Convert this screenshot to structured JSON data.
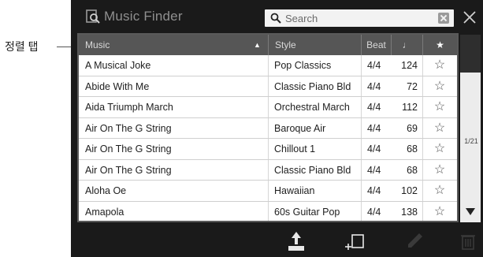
{
  "annotation": {
    "callout_label": "정렬 탭"
  },
  "titlebar": {
    "title": "Music Finder",
    "icon": "music-finder-icon"
  },
  "search": {
    "placeholder": "Search"
  },
  "table": {
    "columns": [
      {
        "key": "music",
        "label": "Music"
      },
      {
        "key": "style",
        "label": "Style"
      },
      {
        "key": "beat",
        "label": "Beat"
      },
      {
        "key": "tempo",
        "label": "♩"
      },
      {
        "key": "favorite",
        "label": "★"
      }
    ],
    "sort_indicator": "▲",
    "rows": [
      {
        "music": "A Musical Joke",
        "style": "Pop Classics",
        "beat": "4/4",
        "tempo": "124",
        "favorite": "☆"
      },
      {
        "music": "Abide With Me",
        "style": "Classic Piano Bld",
        "beat": "4/4",
        "tempo": "72",
        "favorite": "☆"
      },
      {
        "music": "Aida Triumph March",
        "style": "Orchestral March",
        "beat": "4/4",
        "tempo": "112",
        "favorite": "☆"
      },
      {
        "music": "Air On The G String",
        "style": "Baroque Air",
        "beat": "4/4",
        "tempo": "69",
        "favorite": "☆"
      },
      {
        "music": "Air On The G String",
        "style": "Chillout 1",
        "beat": "4/4",
        "tempo": "68",
        "favorite": "☆"
      },
      {
        "music": "Air On The G String",
        "style": "Classic Piano Bld",
        "beat": "4/4",
        "tempo": "68",
        "favorite": "☆"
      },
      {
        "music": "Aloha Oe",
        "style": "Hawaiian",
        "beat": "4/4",
        "tempo": "102",
        "favorite": "☆"
      },
      {
        "music": "Amapola",
        "style": "60s Guitar Pop",
        "beat": "4/4",
        "tempo": "138",
        "favorite": "☆"
      }
    ]
  },
  "pagination": {
    "indicator": "1/21"
  },
  "toolbar": {
    "buttons": [
      "load-icon",
      "add-icon",
      "edit-icon",
      "delete-icon"
    ]
  },
  "colors": {
    "background": "#1a1a1a",
    "header": "#565656",
    "row_bg": "#ffffff"
  }
}
